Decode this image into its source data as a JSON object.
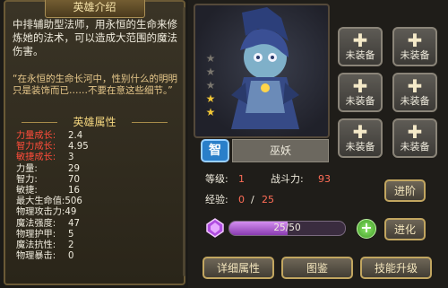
{
  "left_panel": {
    "title": "英雄介绍",
    "description": "中排辅助型法师，用永恒的生命来修炼她的法术，可以造成大范围的魔法伤害。",
    "quote": "“在永恒的生命长河中，性别什么的明明只是装饰而已……不要在意这些细节。”",
    "attributes_header": "英雄属性",
    "growth_stats": [
      {
        "label": "力量成长:",
        "value": "2.4"
      },
      {
        "label": "智力成长:",
        "value": "4.95"
      },
      {
        "label": "敏捷成长:",
        "value": "3"
      }
    ],
    "base_stats": [
      {
        "label": "力量:",
        "value": "29"
      },
      {
        "label": "智力:",
        "value": "70"
      },
      {
        "label": "敏捷:",
        "value": "16"
      },
      {
        "label": "最大生命值:",
        "value": "506"
      },
      {
        "label": "物理攻击力:",
        "value": "49"
      },
      {
        "label": "魔法强度:",
        "value": "47"
      },
      {
        "label": "物理护甲:",
        "value": "5"
      },
      {
        "label": "魔法抗性:",
        "value": "2"
      },
      {
        "label": "物理暴击:",
        "value": "0"
      }
    ]
  },
  "hero": {
    "stars_filled": 2,
    "stars_total": 5,
    "type_badge": "智",
    "name": "巫妖",
    "level_label": "等级:",
    "level_value": "1",
    "power_label": "战斗力:",
    "power_value": "93",
    "exp_label": "经验:",
    "exp_value": "0",
    "exp_separator": "/",
    "exp_max": "25",
    "soulstone_text": "25/50",
    "soulstone_fraction": 0.5
  },
  "equipment_slots": [
    {
      "label": "未装备"
    },
    {
      "label": "未装备"
    },
    {
      "label": "未装备"
    },
    {
      "label": "未装备"
    },
    {
      "label": "未装备"
    },
    {
      "label": "未装备"
    }
  ],
  "buttons": {
    "advance": "进阶",
    "evolve": "进化",
    "details": "详细属性",
    "codex": "图鉴",
    "skill_upgrade": "技能升级"
  },
  "colors": {
    "highlight": "#ff6d57",
    "growth_label": "#ff4c3a",
    "star_on": "#f2c736",
    "badge_blue": "#2a7fc9",
    "exp_purple": "#c17ae6"
  }
}
